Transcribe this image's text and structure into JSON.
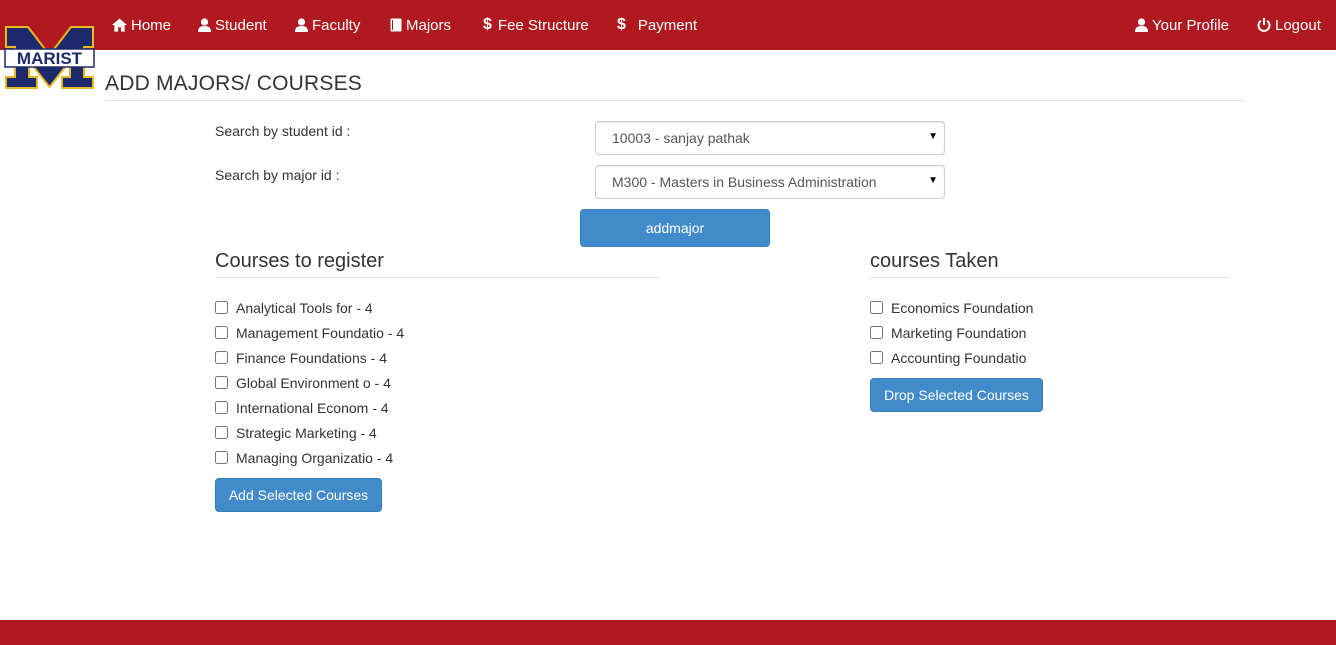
{
  "nav": {
    "home": "Home",
    "student": "Student",
    "faculty": "Faculty",
    "majors": "Majors",
    "fee_structure": "Fee Structure",
    "payment": "Payment",
    "profile": "Your Profile",
    "logout": "Logout"
  },
  "logo_text": "MARIST",
  "page_title": "ADD MAJORS/ COURSES",
  "search": {
    "student_label": "Search by student id :",
    "student_value": "10003 - sanjay pathak",
    "major_label": "Search by major id :",
    "major_value": "M300 - Masters in Business Administration",
    "add_major_button": "addmajor"
  },
  "courses_to_register": {
    "title": "Courses to register",
    "items": [
      "Analytical Tools for - 4",
      "Management Foundatio - 4",
      "Finance Foundations - 4",
      "Global Environment o - 4",
      "International Econom - 4",
      "Strategic Marketing - 4",
      "Managing Organizatio - 4"
    ],
    "button": "Add Selected Courses"
  },
  "courses_taken": {
    "title": "courses Taken",
    "items": [
      "Economics Foundation",
      "Marketing Foundation",
      "Accounting Foundatio"
    ],
    "button": "Drop Selected Courses"
  },
  "colors": {
    "nav_bg": "#b0191f",
    "button_bg": "#428bca",
    "logo_blue": "#1c2a6b",
    "logo_gold": "#e8b920"
  }
}
